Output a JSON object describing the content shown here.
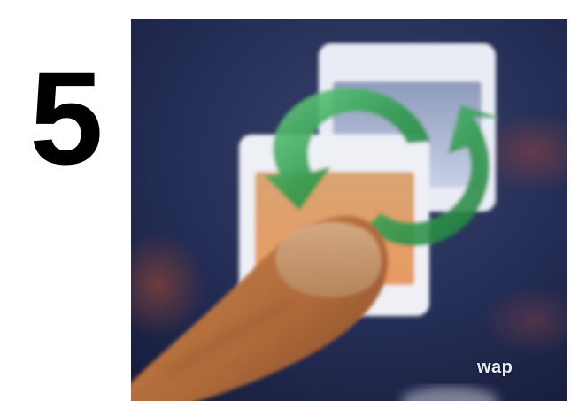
{
  "step": {
    "number": "5"
  },
  "photo": {
    "app_label": "wap",
    "icon_name": "swap-icon",
    "colors": {
      "screen_background": "#1e2950",
      "arrow_green": "#3fae5c",
      "front_card_fill": "#e6a36c",
      "back_card_fill": "#c9cfe0",
      "card_frame": "#eef0f6"
    }
  }
}
